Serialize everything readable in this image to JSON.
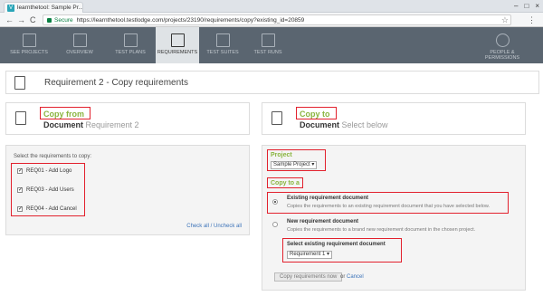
{
  "browser": {
    "tab_title": "learnthetool: Sample Pr...",
    "tab_close": "×",
    "favicon": "V",
    "back": "←",
    "forward": "→",
    "reload": "C",
    "secure_label": "Secure",
    "url": "https://learnthetool.testlodge.com/projects/23190/requirements/copy?existing_id=20859",
    "star": "☆",
    "menu": "⋮",
    "win_min": "–",
    "win_max": "□",
    "win_close": "×"
  },
  "nav": {
    "items": [
      {
        "label": "See Projects"
      },
      {
        "label": "Overview"
      },
      {
        "label": "Test Plans"
      },
      {
        "label": "Requirements"
      },
      {
        "label": "Test Suites"
      },
      {
        "label": "Test Runs"
      },
      {
        "label": "People & Permissions"
      }
    ],
    "active_index": 3
  },
  "page": {
    "title": "Requirement 2 - Copy requirements"
  },
  "copy_from": {
    "heading": "Copy from",
    "doc_label": "Document",
    "doc_name": "Requirement 2",
    "instruction": "Select the requirements to copy:",
    "requirements": [
      {
        "label": "REQ01 - Add Logo",
        "checked": true
      },
      {
        "label": "REQ03 - Add Users",
        "checked": true
      },
      {
        "label": "REQ04 - Add Cancel",
        "checked": true
      }
    ],
    "check_all": "Check all",
    "separator": "/",
    "uncheck_all": "Uncheck all"
  },
  "copy_to": {
    "heading": "Copy to",
    "doc_label": "Document",
    "doc_hint": "Select below",
    "project_label": "Project",
    "project_value": "Sample Project ▾",
    "copy_to_a_label": "Copy to a",
    "option_existing_title": "Existing requirement document",
    "option_existing_desc": "Copies the requirements to an existing requirement document that you have selected below.",
    "option_new_title": "New requirement document",
    "option_new_desc": "Copies the requirements to a brand new requirement document in the chosen project.",
    "select_existing_label": "Select existing requirement document",
    "select_existing_value": "Requirement 1 ▾",
    "copy_button": "Copy requirements now",
    "or_text": "or",
    "cancel_link": "Cancel"
  },
  "colors": {
    "highlight_box": "#e2212d",
    "label_green": "#8ab43f",
    "nav_bg": "#5a6570",
    "link_blue": "#3b73b9"
  }
}
